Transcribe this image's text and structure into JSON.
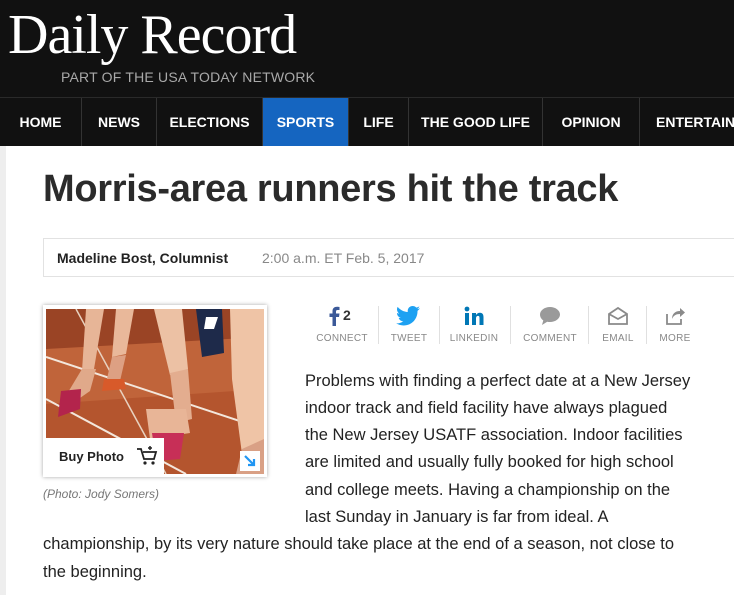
{
  "site": {
    "logo": "Daily Record",
    "tagline": "PART OF THE USA TODAY NETWORK"
  },
  "nav": {
    "items": [
      {
        "label": "HOME"
      },
      {
        "label": "NEWS"
      },
      {
        "label": "ELECTIONS"
      },
      {
        "label": "SPORTS",
        "active": true
      },
      {
        "label": "LIFE"
      },
      {
        "label": "THE GOOD LIFE"
      },
      {
        "label": "OPINION"
      },
      {
        "label": "ENTERTAINM"
      }
    ],
    "active_color": "#1565c0"
  },
  "article": {
    "title": "Morris-area runners hit the track",
    "author": "Madeline Bost, Columnist",
    "timestamp": "2:00 a.m. ET Feb. 5, 2017",
    "photo": {
      "buy_label": "Buy Photo",
      "caption": "(Photo: Jody Somers)"
    },
    "share": {
      "facebook": {
        "label": "CONNECT",
        "count": "2",
        "icon": "facebook-icon"
      },
      "twitter": {
        "label": "TWEET",
        "icon": "twitter-icon"
      },
      "linkedin": {
        "label": "LINKEDIN",
        "icon": "linkedin-icon"
      },
      "comment": {
        "label": "COMMENT",
        "icon": "comment-icon"
      },
      "email": {
        "label": "EMAIL",
        "icon": "email-icon"
      },
      "more": {
        "label": "MORE",
        "icon": "share-icon"
      }
    },
    "body_lines": [
      "Problems with finding a perfect date at a New Jersey",
      "indoor track and field facility have always plagued",
      "the New Jersey USATF association.  Indoor facilities",
      "are limited and usually fully booked for high school",
      "and college meets.  Having a championship on the",
      "last Sunday in January is far from ideal.  A",
      "championship, by its very nature should take place at the end of a season, not close to",
      "the beginning."
    ]
  }
}
